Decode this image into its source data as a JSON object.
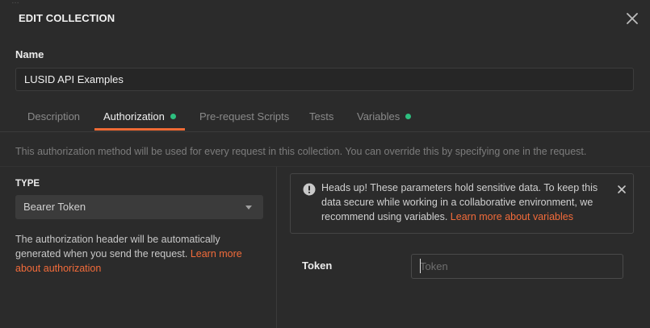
{
  "dialog": {
    "title": "EDIT COLLECTION",
    "background_fragment": "…"
  },
  "name": {
    "label": "Name",
    "value": "LUSID API Examples"
  },
  "tabs": [
    {
      "label": "Description",
      "active": false,
      "dot": false
    },
    {
      "label": "Authorization",
      "active": true,
      "dot": true
    },
    {
      "label": "Pre-request Scripts",
      "active": false,
      "dot": false
    },
    {
      "label": "Tests",
      "active": false,
      "dot": false
    },
    {
      "label": "Variables",
      "active": false,
      "dot": true
    }
  ],
  "authorization": {
    "description": "This authorization method will be used for every request in this collection. You can override this by specifying one in the request.",
    "type_label": "TYPE",
    "type_value": "Bearer Token",
    "help_text": "The authorization header will be automatically generated when you send the request. ",
    "help_link": "Learn more about authorization",
    "alert": {
      "text": "Heads up! These parameters hold sensitive data. To keep this data secure while working in a collaborative environment, we recommend using variables. ",
      "link": "Learn more about variables"
    },
    "token": {
      "label": "Token",
      "value": "",
      "placeholder": "Token"
    }
  },
  "colors": {
    "accent": "#ef6a35",
    "dot": "#2dbf7f",
    "background": "#2b2b2b"
  },
  "icons": {
    "close": "close-icon",
    "alert": "exclamation-circle-icon",
    "alert_close": "close-icon",
    "select": "chevron-down-icon"
  }
}
